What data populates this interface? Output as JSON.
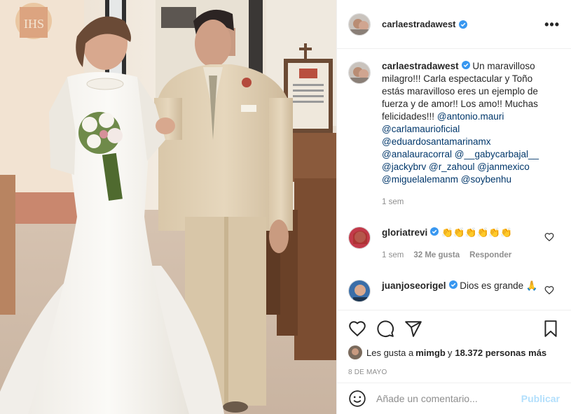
{
  "post": {
    "username": "carlaestradawest",
    "more_icon": "more-options-icon"
  },
  "caption": {
    "username": "carlaestradawest",
    "text": "Un maravilloso milagro!!! Carla espectacular y Toño estás maravilloso eres un ejemplo de fuerza y de amor!! Los amo!! Muchas felicidades!!!",
    "mentions": [
      "@antonio.mauri",
      "@carlamaurioficial",
      "@eduardosantamarinamx",
      "@analauracorral",
      "@__gabycarbajal__",
      "@jackybrv",
      "@r_zahoul",
      "@janmexico",
      "@miguelalemanm",
      "@soybenhu"
    ],
    "time": "1 sem"
  },
  "comments": [
    {
      "username": "gloriatrevi",
      "text": "👏👏👏👏👏👏",
      "time": "1 sem",
      "likes": "32 Me gusta",
      "reply": "Responder"
    },
    {
      "username": "juanjoseorigel",
      "text": "Dios es grande 🙏"
    }
  ],
  "likes": {
    "prefix": "Les gusta a",
    "user": "mimgb",
    "joiner": "y",
    "count": "18.372 personas más"
  },
  "date": "8 DE MAYO",
  "add_comment": {
    "placeholder": "Añade un comentario...",
    "publish": "Publicar"
  },
  "colors": {
    "verified": "#3897f0",
    "mention": "#00376b",
    "muted": "#8e8e8e",
    "publish_disabled": "#b2dffc"
  }
}
